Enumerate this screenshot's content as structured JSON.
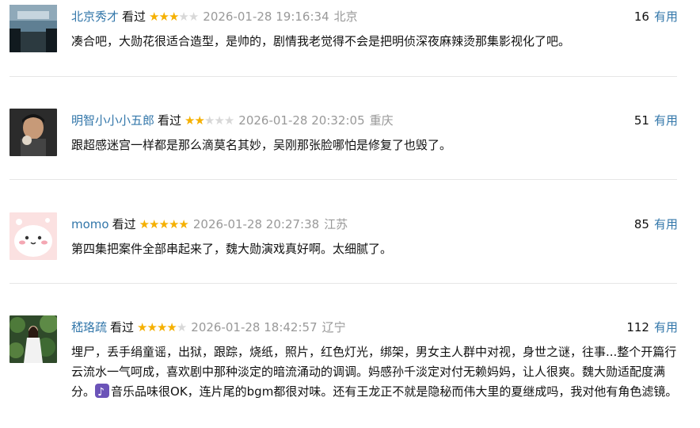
{
  "comments": [
    {
      "user": "北京秀才",
      "watched": "看过",
      "stars": [
        "on",
        "on",
        "on",
        "off",
        "off"
      ],
      "time": "2026-01-28 19:16:34",
      "location": "北京",
      "votes": "16",
      "vote_label": "有用",
      "text": "凑合吧，大勋花很适合造型，是帅的，剧情我老觉得不会是把明侦深夜麻辣烫那集影视化了吧。"
    },
    {
      "user": "明智小小小五郎",
      "watched": "看过",
      "stars": [
        "on",
        "on",
        "off",
        "off",
        "off"
      ],
      "time": "2026-01-28 20:32:05",
      "location": "重庆",
      "votes": "51",
      "vote_label": "有用",
      "text": "跟超感迷宫一样都是那么滴莫名其妙，吴刚那张脸哪怕是修复了也毁了。"
    },
    {
      "user": "momo",
      "watched": "看过",
      "stars": [
        "on",
        "on",
        "on",
        "on",
        "on"
      ],
      "time": "2026-01-28 20:27:38",
      "location": "江苏",
      "votes": "85",
      "vote_label": "有用",
      "text": "第四集把案件全部串起来了，魏大勋演戏真好啊。太细腻了。"
    },
    {
      "user": "嵇珞疏",
      "watched": "看过",
      "stars": [
        "on",
        "on",
        "on",
        "on",
        "off"
      ],
      "time": "2026-01-28 18:42:57",
      "location": "辽宁",
      "votes": "112",
      "vote_label": "有用",
      "text_part1": "埋尸，丢手绢童谣，出狱，跟踪，烧纸，照片，红色灯光，绑架，男女主人群中对视，身世之谜，往事...整个开篇行云流水一气呵成，喜欢剧中那种淡定的暗流涌动的调调。妈感孙千淡定对付无赖妈妈，让人很爽。魏大勋适配度满分。",
      "text_part2": "音乐品味很OK，连片尾的bgm都很对味。还有王龙正不就是隐秘而伟大里的夏继成吗，我对他有角色滤镜。"
    }
  ],
  "colors": {
    "link": "#3377aa",
    "star_on": "#f5b000",
    "star_off": "#d8d8d8",
    "meta_gray": "#999999"
  },
  "icons": {
    "star": "★",
    "music_note_emoji": "music-note-icon"
  }
}
